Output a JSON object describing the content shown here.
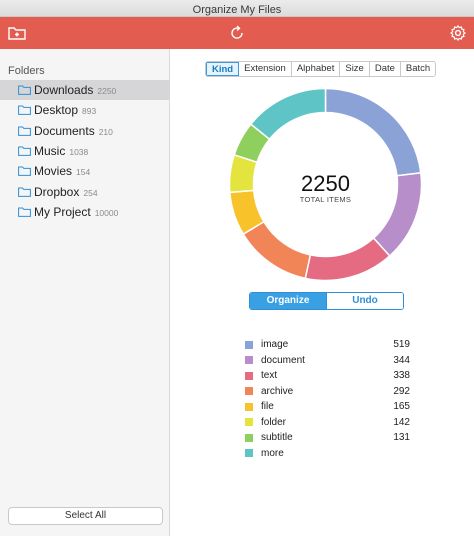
{
  "window": {
    "title": "Organize My Files"
  },
  "toolbar": {
    "icons": [
      "new-folder-icon",
      "refresh-icon",
      "gear-icon"
    ],
    "color": "#e25c50"
  },
  "sidebar": {
    "header": "Folders",
    "items": [
      {
        "name": "Downloads",
        "count": "2250",
        "selected": true
      },
      {
        "name": "Desktop",
        "count": "893",
        "selected": false
      },
      {
        "name": "Documents",
        "count": "210",
        "selected": false
      },
      {
        "name": "Music",
        "count": "1038",
        "selected": false
      },
      {
        "name": "Movies",
        "count": "154",
        "selected": false
      },
      {
        "name": "Dropbox",
        "count": "254",
        "selected": false
      },
      {
        "name": "My Project",
        "count": "10000",
        "selected": false
      }
    ],
    "select_all_label": "Select All"
  },
  "sort_tabs": {
    "items": [
      "Kind",
      "Extension",
      "Alphabet",
      "Size",
      "Date",
      "Batch"
    ],
    "active": "Kind"
  },
  "summary": {
    "total": "2250",
    "total_label": "TOTAL ITEMS"
  },
  "actions": {
    "organize_label": "Organize",
    "undo_label": "Undo"
  },
  "chart_data": {
    "type": "pie",
    "donut": true,
    "center_value": 2250,
    "center_label": "TOTAL ITEMS",
    "series": [
      {
        "name": "image",
        "value": 519,
        "color": "#8aa2d6"
      },
      {
        "name": "document",
        "value": 344,
        "color": "#b78ec9"
      },
      {
        "name": "text",
        "value": 338,
        "color": "#e46b82"
      },
      {
        "name": "archive",
        "value": 292,
        "color": "#f18558"
      },
      {
        "name": "file",
        "value": 165,
        "color": "#f8c22a"
      },
      {
        "name": "folder",
        "value": 142,
        "color": "#e3e43e"
      },
      {
        "name": "subtitle",
        "value": 131,
        "color": "#8fcf5e"
      },
      {
        "name": "more",
        "value": 319,
        "color": "#5fc4c5"
      }
    ]
  },
  "legend": [
    {
      "label": "image",
      "value": "519",
      "color": "#8aa2d6"
    },
    {
      "label": "document",
      "value": "344",
      "color": "#b78ec9"
    },
    {
      "label": "text",
      "value": "338",
      "color": "#e46b82"
    },
    {
      "label": "archive",
      "value": "292",
      "color": "#f18558"
    },
    {
      "label": "file",
      "value": "165",
      "color": "#f8c22a"
    },
    {
      "label": "folder",
      "value": "142",
      "color": "#e3e43e"
    },
    {
      "label": "subtitle",
      "value": "131",
      "color": "#8fcf5e"
    },
    {
      "label": "more",
      "value": "",
      "color": "#5fc4c5"
    }
  ]
}
